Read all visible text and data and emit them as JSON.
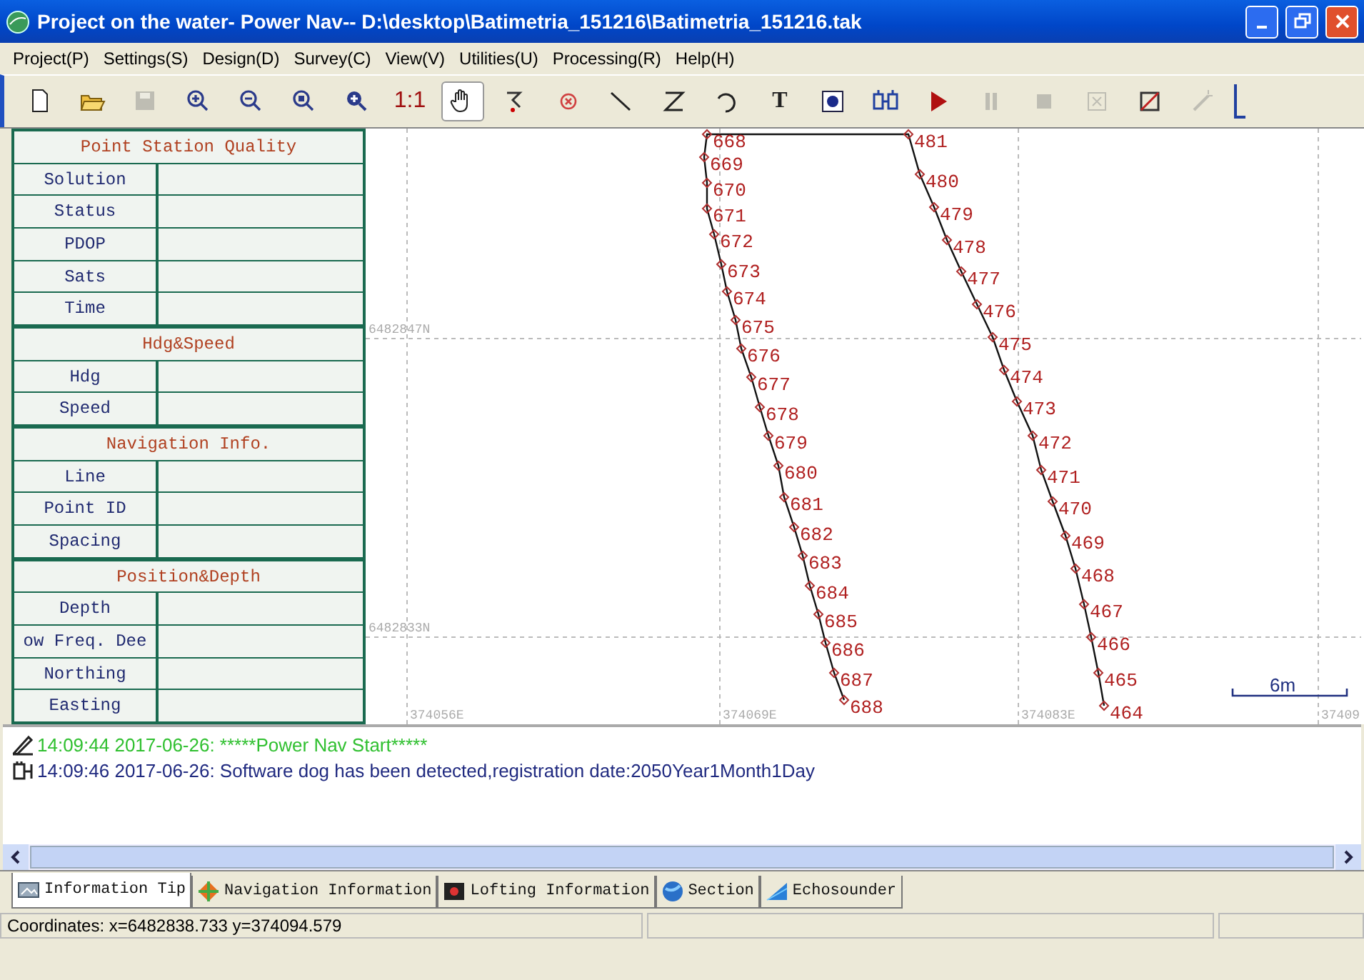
{
  "window": {
    "title": "Project on the water- Power Nav-- D:\\desktop\\Batimetria_151216\\Batimetria_151216.tak"
  },
  "menu": [
    "Project(P)",
    "Settings(S)",
    "Design(D)",
    "Survey(C)",
    "View(V)",
    "Utilities(U)",
    "Processing(R)",
    "Help(H)"
  ],
  "toolbar": [
    {
      "kind": "new",
      "disabled": false,
      "selected": false
    },
    {
      "kind": "open",
      "disabled": false,
      "selected": false
    },
    {
      "kind": "save",
      "disabled": true,
      "selected": false
    },
    {
      "kind": "zoomin",
      "disabled": false,
      "selected": false
    },
    {
      "kind": "zoomout",
      "disabled": false,
      "selected": false
    },
    {
      "kind": "zoomwin",
      "disabled": false,
      "selected": false
    },
    {
      "kind": "zoomall",
      "disabled": false,
      "selected": false
    },
    {
      "kind": "text",
      "label": "1:1",
      "disabled": false,
      "selected": false
    },
    {
      "kind": "hand",
      "disabled": false,
      "selected": true
    },
    {
      "kind": "undo",
      "disabled": false,
      "selected": false
    },
    {
      "kind": "cancel",
      "disabled": false,
      "selected": false
    },
    {
      "kind": "line",
      "disabled": false,
      "selected": false
    },
    {
      "kind": "zline",
      "disabled": false,
      "selected": false
    },
    {
      "kind": "arc",
      "disabled": false,
      "selected": false
    },
    {
      "kind": "text",
      "label": "T",
      "disabled": false,
      "selected": false
    },
    {
      "kind": "record",
      "disabled": false,
      "selected": false
    },
    {
      "kind": "device",
      "disabled": false,
      "selected": false
    },
    {
      "kind": "play",
      "disabled": false,
      "selected": false
    },
    {
      "kind": "pause",
      "disabled": true,
      "selected": false
    },
    {
      "kind": "stop",
      "disabled": true,
      "selected": false
    },
    {
      "kind": "xbox",
      "disabled": true,
      "selected": false
    },
    {
      "kind": "slashbox",
      "disabled": false,
      "selected": false
    },
    {
      "kind": "wand",
      "disabled": true,
      "selected": false
    }
  ],
  "info_table": [
    {
      "title": "Point Station Quality",
      "rows": [
        "Solution",
        "Status",
        "PDOP",
        "Sats",
        "Time"
      ]
    },
    {
      "title": "Hdg&Speed",
      "rows": [
        "Hdg",
        "Speed"
      ]
    },
    {
      "title": "Navigation Info.",
      "rows": [
        "Line",
        "Point ID",
        "Spacing"
      ]
    },
    {
      "title": "Position&Depth",
      "rows": [
        "Depth",
        "ow Freq. Dee",
        "Northing",
        "Easting"
      ]
    }
  ],
  "map": {
    "northings": [
      "6482847N",
      "6482833N"
    ],
    "eastings": [
      "374056E",
      "374069E",
      "374083E",
      "37409"
    ],
    "lines": [
      {
        "points": [
          "668",
          "669",
          "670",
          "671",
          "672",
          "673",
          "674",
          "675",
          "676",
          "677",
          "678",
          "679",
          "680",
          "681",
          "682",
          "683",
          "684",
          "685",
          "686",
          "687",
          "688"
        ]
      },
      {
        "points": [
          "481",
          "480",
          "479",
          "478",
          "477",
          "476",
          "475",
          "474",
          "473",
          "472",
          "471",
          "470",
          "469",
          "468",
          "467",
          "466",
          "465",
          "464"
        ]
      }
    ],
    "scale": "6m"
  },
  "log": [
    {
      "kind": "start",
      "text": "14:09:44 2017-06-26: *****Power Nav Start*****"
    },
    {
      "kind": "info",
      "text": "14:09:46 2017-06-26: Software dog has been detected,registration date:2050Year1Month1Day"
    }
  ],
  "tabs": [
    {
      "label": "Information Tip",
      "selected": true
    },
    {
      "label": "Navigation Information",
      "selected": false
    },
    {
      "label": "Lofting Information",
      "selected": false
    },
    {
      "label": "Section",
      "selected": false
    },
    {
      "label": "Echosounder",
      "selected": false
    }
  ],
  "status_bar": {
    "coordinates": "Coordinates: x=6482838.733 y=374094.579"
  }
}
